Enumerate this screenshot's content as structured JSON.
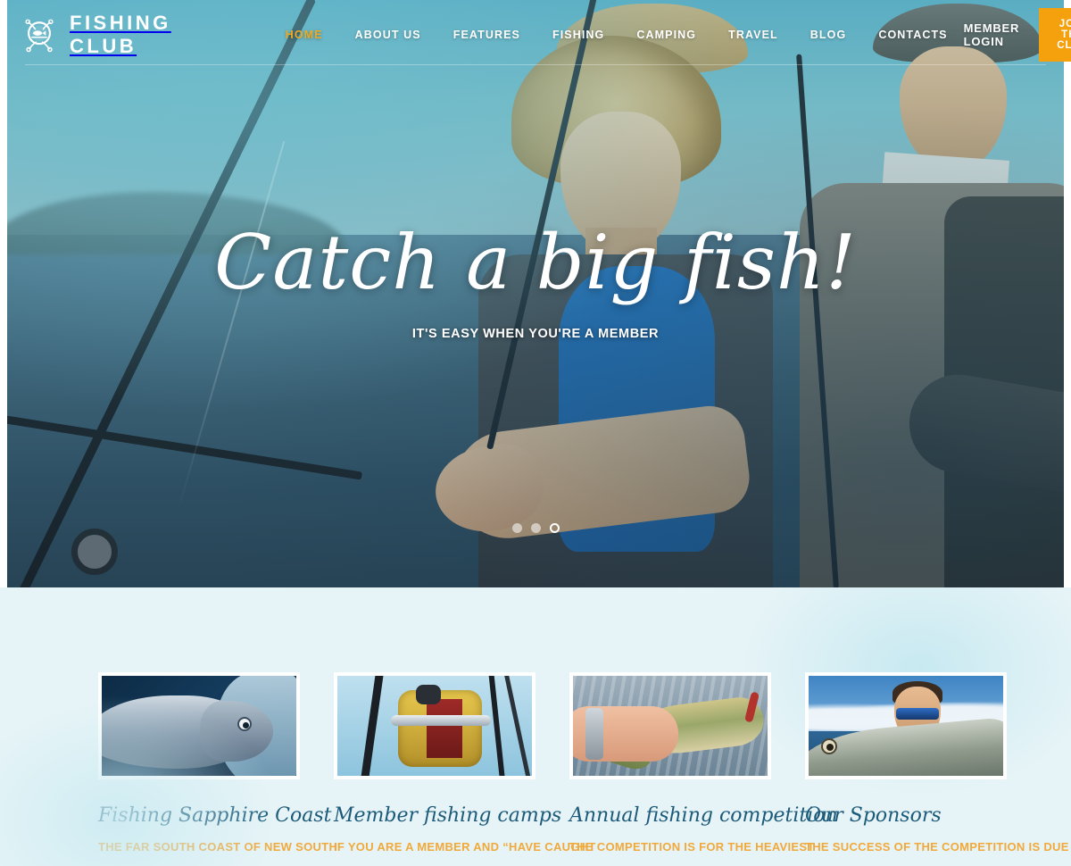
{
  "header": {
    "logo_icon": "fish-badge-icon",
    "brand": "FISHING CLUB",
    "nav": [
      {
        "label": "HOME",
        "active": true
      },
      {
        "label": "ABOUT US",
        "active": false
      },
      {
        "label": "FEATURES",
        "active": false
      },
      {
        "label": "FISHING",
        "active": false
      },
      {
        "label": "CAMPING",
        "active": false
      },
      {
        "label": "TRAVEL",
        "active": false
      },
      {
        "label": "BLOG",
        "active": false
      },
      {
        "label": "CONTACTS",
        "active": false
      }
    ],
    "member_login": "MEMBER LOGIN",
    "join_button": "JOIN THE CLUB",
    "accent_color": "#f5a00d",
    "nav_active_color": "#f0a91e"
  },
  "hero": {
    "title": "Catch a big fish!",
    "subtitle": "IT'S EASY WHEN YOU'RE A MEMBER",
    "slides": [
      {
        "label": "slide-1",
        "active": false
      },
      {
        "label": "slide-2",
        "active": false
      },
      {
        "label": "slide-3",
        "active": true
      }
    ]
  },
  "features": {
    "background_color": "#e7f4f7",
    "title_color": "#1c5a7a",
    "text_color": "#f0a93a",
    "cards": [
      {
        "image": "fish-closeup-photo",
        "title": "Fishing Sapphire Coast",
        "text": "THE FAR SOUTH COAST OF NEW SOUTH"
      },
      {
        "image": "fishing-reel-photo",
        "title": "Member fishing camps",
        "text": "IF YOU ARE A MEMBER AND “HAVE CAUGHT"
      },
      {
        "image": "trout-in-hand-photo",
        "title": "Annual fishing competition",
        "text": "THE COMPETITION IS FOR THE HEAVIEST"
      },
      {
        "image": "angler-with-fish-photo",
        "title": "Our Sponsors",
        "text": "THE SUCCESS OF THE COMPETITION IS DUE"
      }
    ]
  }
}
